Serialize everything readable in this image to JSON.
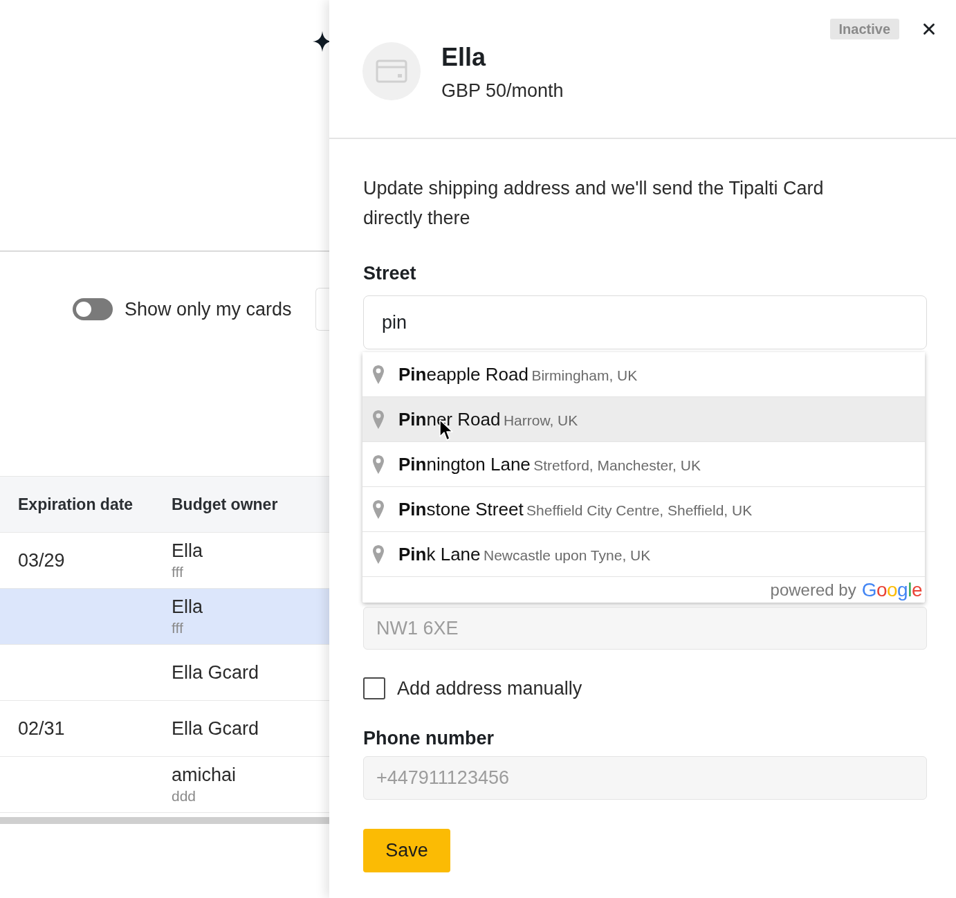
{
  "page": {
    "filter_toggle": {
      "label": "Show only my cards",
      "on": false
    },
    "table": {
      "columns": [
        "Expiration date",
        "Budget owner"
      ],
      "rows": [
        {
          "expiration_date": "03/29",
          "owner": "Ella",
          "owner_note": "fff",
          "selected": false
        },
        {
          "owner": "Ella",
          "owner_note": "fff",
          "selected": true
        },
        {
          "owner": "Ella Gcard",
          "selected": false
        },
        {
          "expiration_date": "02/31",
          "owner": "Ella Gcard",
          "selected": false
        },
        {
          "owner": "amichai",
          "owner_note": "ddd",
          "selected": false
        }
      ]
    }
  },
  "drawer": {
    "title": "Ella",
    "subtitle": "GBP 50/month",
    "status_badge": "Inactive",
    "description": "Update shipping address and we'll send the Tipalti Card directly there",
    "street": {
      "label": "Street",
      "value": "pin"
    },
    "suggestions": {
      "items": [
        {
          "main": "**Pin**eapple Road",
          "secondary": "Birmingham, UK",
          "hovered": false
        },
        {
          "main": "**Pin**ner Road",
          "secondary": "Harrow, UK",
          "hovered": true
        },
        {
          "main": "**Pin**nington Lane",
          "secondary": "Stretford, Manchester, UK",
          "hovered": false
        },
        {
          "main": "**Pin**stone Street",
          "secondary": "Sheffield City Centre, Sheffield, UK",
          "hovered": false
        },
        {
          "main": "**Pin**k Lane",
          "secondary": "Newcastle upon Tyne, UK",
          "hovered": false
        }
      ],
      "attribution": "powered by",
      "logo": "Google"
    },
    "postcode": {
      "placeholder": "NW1 6XE"
    },
    "manual_address": {
      "label": "Add address manually",
      "checked": false
    },
    "phone": {
      "label": "Phone number",
      "placeholder": "+447911123456"
    },
    "save_button": "Save"
  }
}
